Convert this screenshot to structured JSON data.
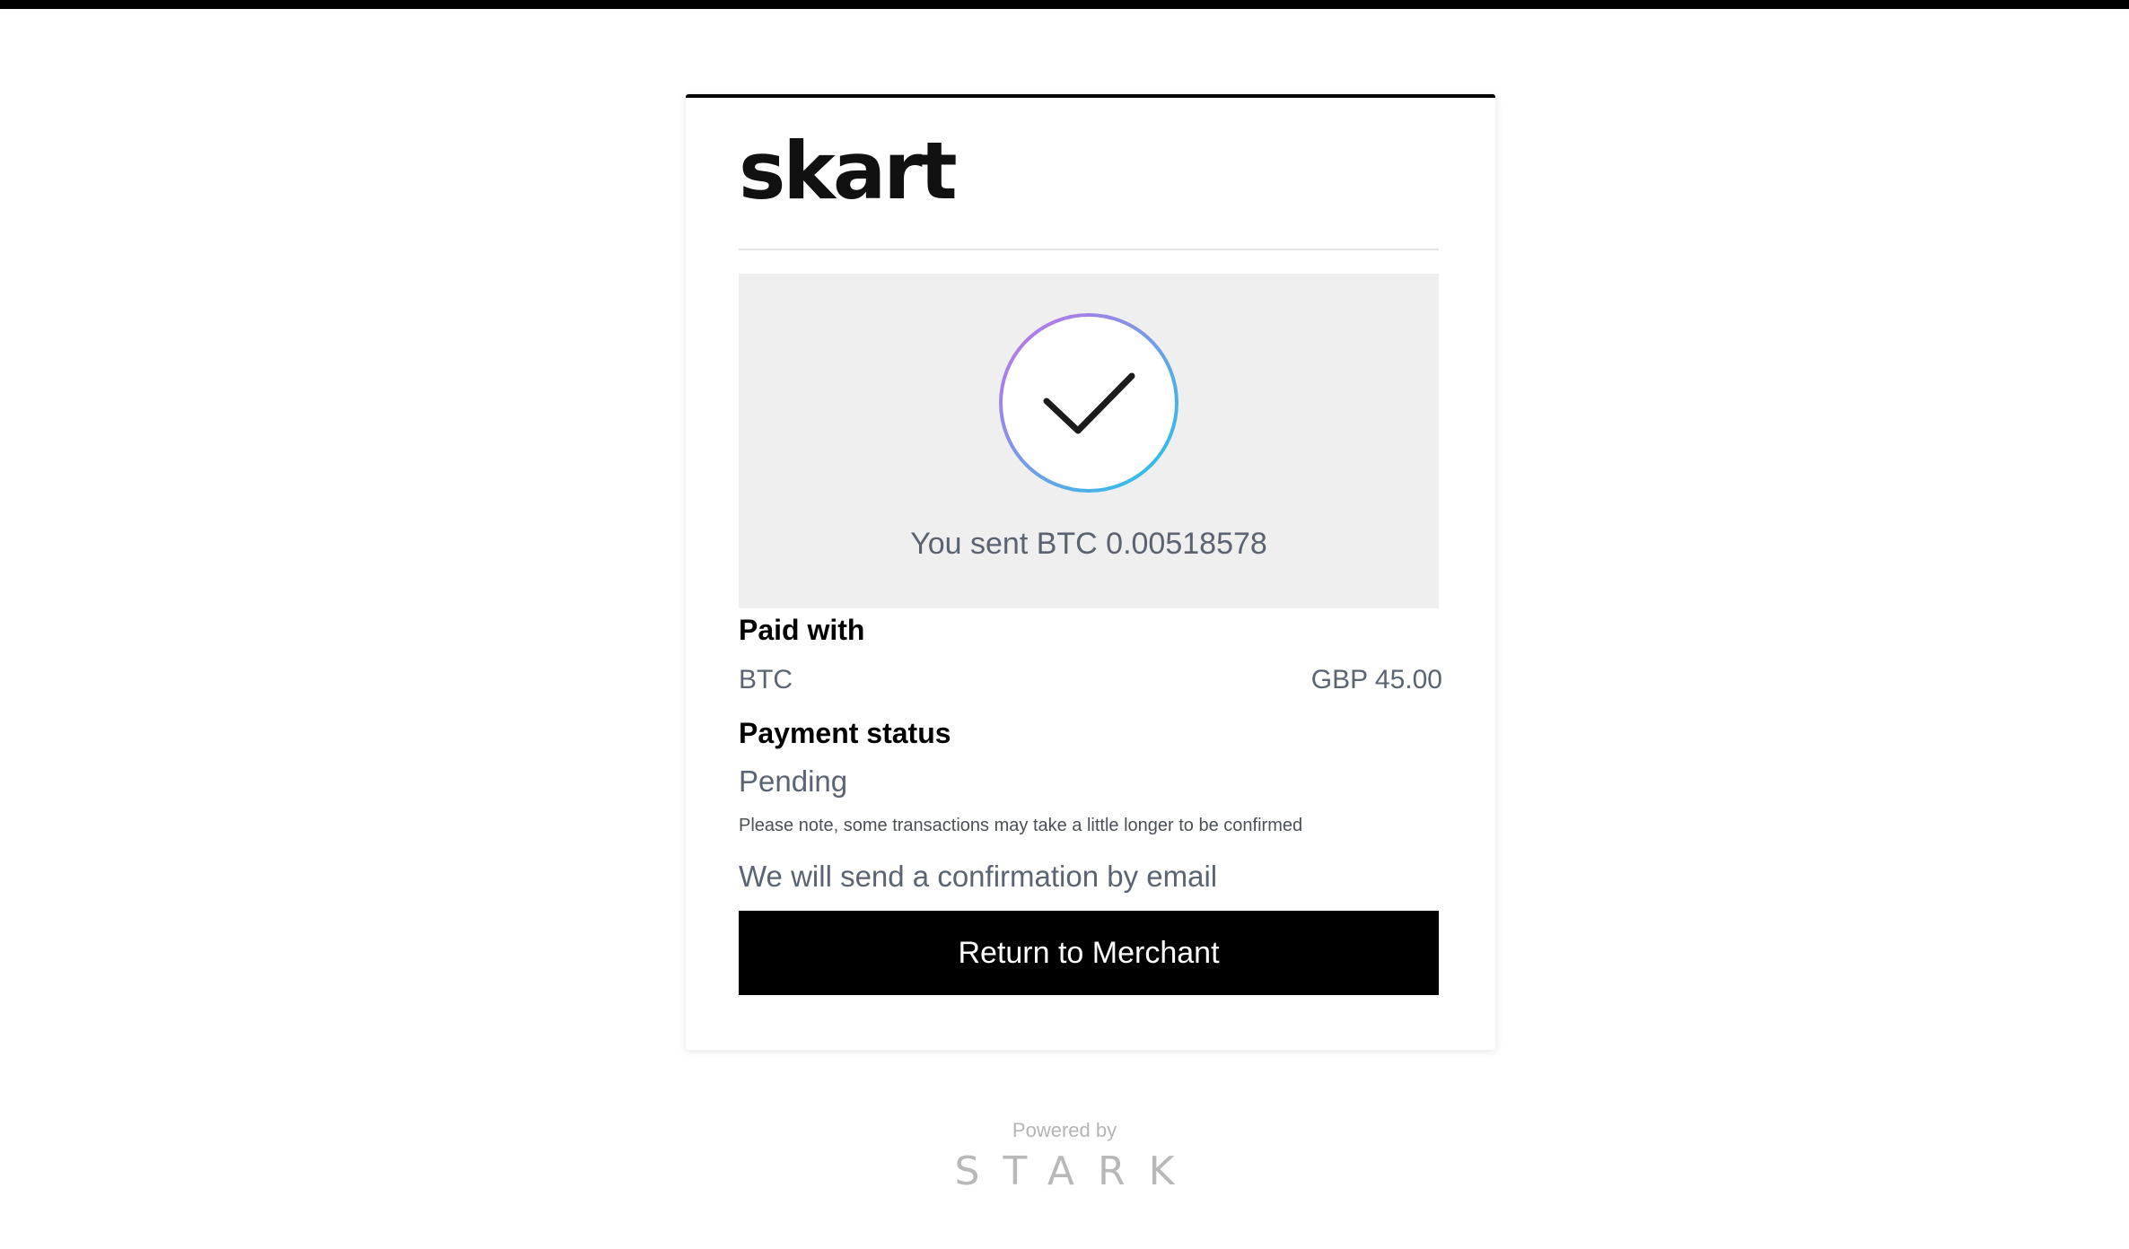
{
  "merchant": {
    "logo_text": "skart"
  },
  "confirmation": {
    "icon": "check-circle-icon",
    "sent_text": "You sent BTC 0.00518578"
  },
  "payment": {
    "paid_with_label": "Paid with",
    "currency": "BTC",
    "amount": "GBP 45.00",
    "status_label": "Payment status",
    "status": "Pending",
    "note": "Please note, some transactions may take a little longer to be confirmed",
    "email_note": "We will send a confirmation by email"
  },
  "actions": {
    "return_label": "Return to Merchant"
  },
  "footer": {
    "powered_by": "Powered by",
    "brand": "STARK"
  },
  "colors": {
    "button_bg": "#000000",
    "panel_bg": "#efefef",
    "ring_gradient_start": "#c86ee8",
    "ring_gradient_end": "#1ec8e8"
  }
}
